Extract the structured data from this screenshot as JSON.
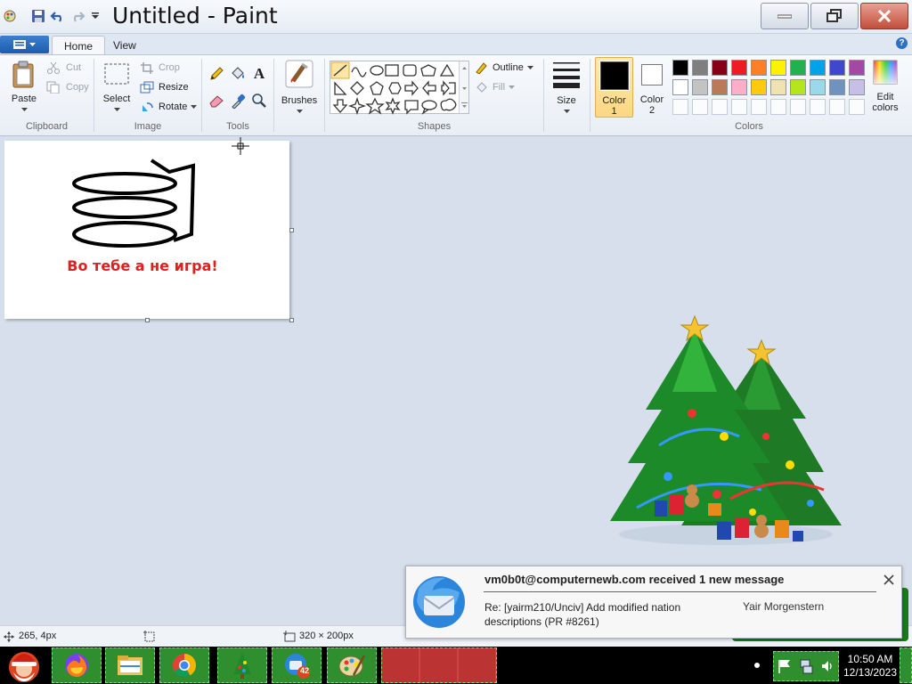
{
  "window": {
    "title": "Untitled - Paint"
  },
  "tabs": {
    "home": "Home",
    "view": "View"
  },
  "clipboard": {
    "paste": "Paste",
    "cut": "Cut",
    "copy": "Copy",
    "group": "Clipboard"
  },
  "image": {
    "select": "Select",
    "crop": "Crop",
    "resize": "Resize",
    "rotate": "Rotate",
    "group": "Image"
  },
  "tools": {
    "group": "Tools",
    "text_tool": "A"
  },
  "brushes": {
    "label": "Brushes"
  },
  "shapes": {
    "group": "Shapes",
    "outline": "Outline",
    "fill": "Fill"
  },
  "size": {
    "label": "Size"
  },
  "color1": {
    "label": "Color",
    "num": "1",
    "value": "#000000"
  },
  "color2": {
    "label": "Color",
    "num": "2",
    "value": "#ffffff"
  },
  "colors": {
    "group": "Colors",
    "edit_label": "Edit",
    "edit_label2": "colors",
    "row1": [
      "#000000",
      "#7f7f7f",
      "#880015",
      "#ed1c24",
      "#ff7f27",
      "#fff200",
      "#22b14c",
      "#00a2e8",
      "#3f48cc",
      "#a349a4"
    ],
    "row2": [
      "#ffffff",
      "#c3c3c3",
      "#b97a57",
      "#ffaec9",
      "#ffc90e",
      "#efe4b0",
      "#b5e61d",
      "#99d9ea",
      "#7092be",
      "#c8bfe7"
    ]
  },
  "canvas": {
    "text": "Во тебе а не игра!",
    "text_color": "#e02020"
  },
  "status": {
    "cursor_pos": "265, 4px",
    "size": "320 × 200px"
  },
  "notification": {
    "title": "vm0b0t@computernewb.com received 1 new message",
    "subject": "Re: [yairm210/Unciv] Add modified nation descriptions (PR #8261)",
    "sender": "Yair Morgenstern"
  },
  "taskbar": {
    "badge": "42",
    "time": "10:50 AM",
    "date": "12/13/2023"
  }
}
